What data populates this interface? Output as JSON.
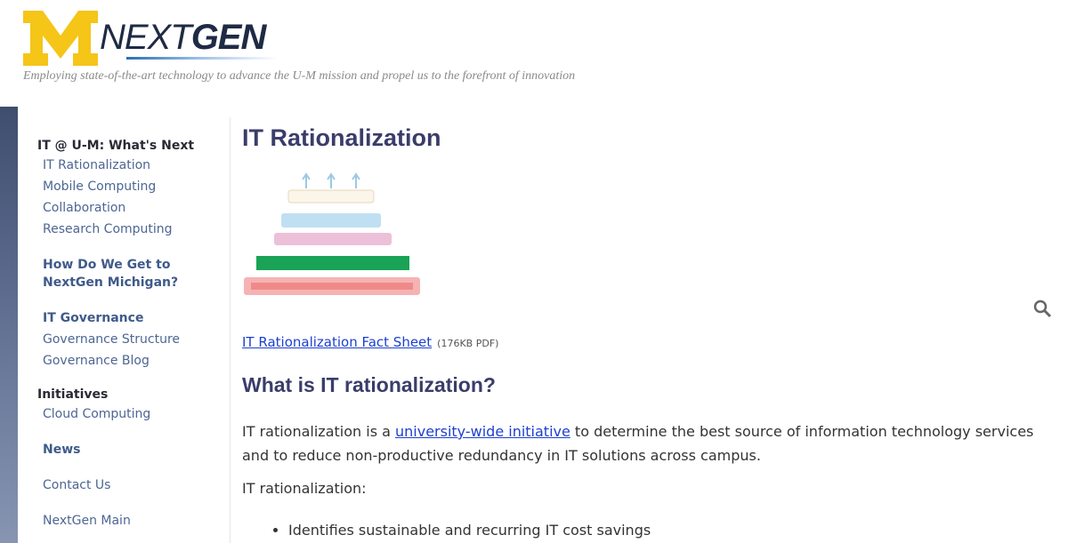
{
  "header": {
    "logo_letter": "M",
    "logo_next": "NEXT",
    "logo_gen": "GEN",
    "tagline": "Employing state-of-the-art technology to advance the U-M mission and propel us to the forefront of innovation"
  },
  "sidebar": {
    "section1_heading": "IT @ U-M: What's Next",
    "section1_items": [
      "IT Rationalization",
      "Mobile Computing",
      "Collaboration",
      "Research Computing"
    ],
    "how_link_line1": "How Do We Get to",
    "how_link_line2": "NextGen Michigan?",
    "governance_items": [
      "IT Governance",
      "Governance Structure",
      "Governance Blog"
    ],
    "initiatives_heading": "Initiatives",
    "initiatives_items": [
      "Cloud Computing"
    ],
    "news": "News",
    "contact": "Contact Us",
    "main_link": "NextGen Main"
  },
  "main": {
    "title": "IT Rationalization",
    "factsheet_link": "IT Rationalization Fact Sheet",
    "factsheet_note": "(176KB PDF)",
    "subheading": "What is IT rationalization?",
    "para_before_link": "IT rationalization is a ",
    "para_link": "university-wide initiative",
    "para_after_link": " to determine the best source of information technology services and to reduce non-productive redundancy in IT solutions across campus.",
    "para2": "IT rationalization:",
    "bullets": [
      "Identifies sustainable and recurring IT cost savings"
    ],
    "zoom_icon": "magnifier-icon"
  },
  "colors": {
    "maize": "#f5c518",
    "blue": "#1f2a44",
    "link": "#1d3fd1",
    "heading": "#3a3d6a",
    "sidebar_link": "#4d6694",
    "diagram_green": "#1aa356",
    "diagram_red": "#f2a3a3",
    "diagram_pink": "#ecc0d8",
    "diagram_blue": "#bfe0f2"
  }
}
